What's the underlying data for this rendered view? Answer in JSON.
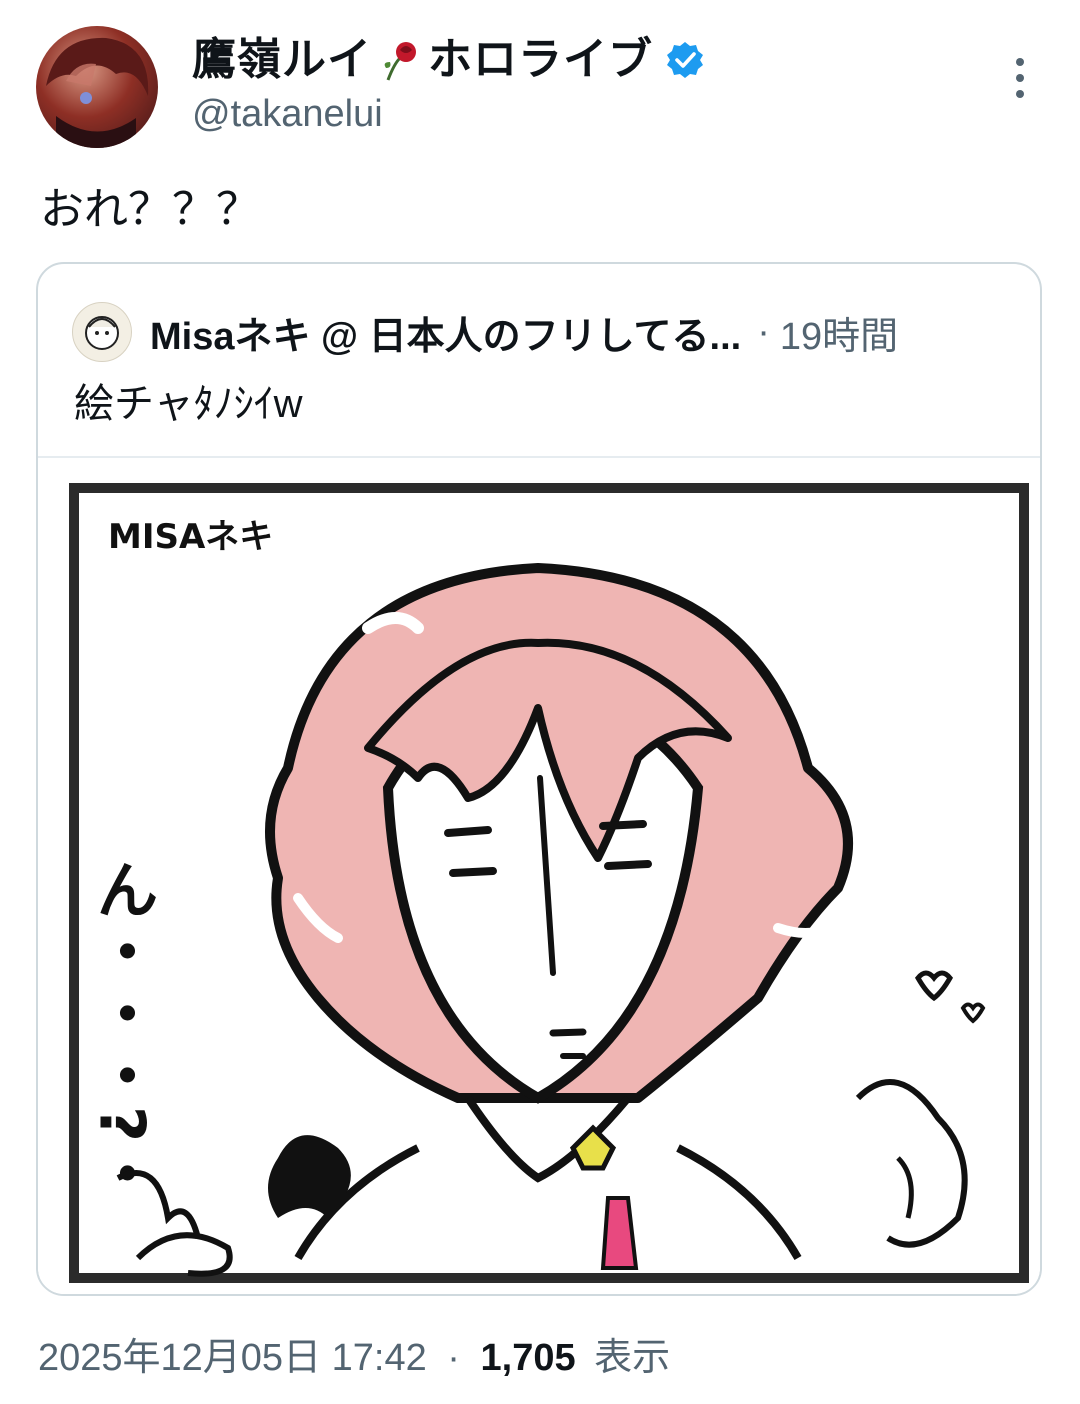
{
  "author": {
    "display_name": "鷹嶺ルイ",
    "display_name_suffix": "ホロライブ",
    "handle": "@takanelui",
    "avatar_icon": "avatar-image",
    "verified_color": "#1d9bf0"
  },
  "tweet": {
    "text": "おれ？？？"
  },
  "quote": {
    "author_name": "Misaネキ @ 日本人のフリしてる...",
    "separator": "·",
    "time": "19時間",
    "text": "絵チャﾀﾉｼｲw",
    "image": {
      "caption": "MISAネキ",
      "side_text": "ん・・・?・"
    }
  },
  "footer": {
    "timestamp": "2025年12月05日 17:42",
    "separator": "·",
    "views_count": "1,705",
    "views_label": "表示"
  },
  "colors": {
    "text": "#0f1419",
    "secondary": "#536471",
    "border": "#cfd9de",
    "hair_pink": "#efb5b3",
    "tie": "#e8497f",
    "badge_yellow": "#e8e04a"
  }
}
